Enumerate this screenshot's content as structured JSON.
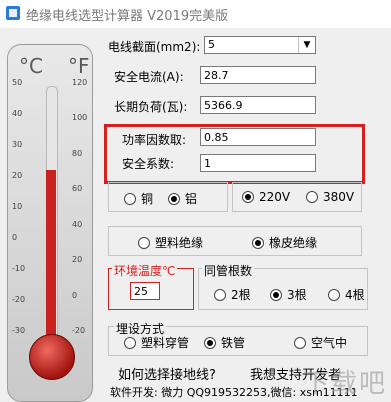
{
  "window": {
    "title": "绝缘电线选型计算器 V2019完美版"
  },
  "thermometer": {
    "celsius_label": "°C",
    "fahrenheit_label": "°F",
    "celsius_scale": [
      "50",
      "40",
      "30",
      "20",
      "10",
      "0",
      "-10",
      "-20",
      "-30"
    ],
    "fahrenheit_scale": [
      "120",
      "100",
      "80",
      "60",
      "40",
      "20",
      "0",
      "-20"
    ],
    "fill_level_celsius": 25
  },
  "fields": {
    "section_label": "电线截面(mm2):",
    "section_value": "5",
    "current_label": "安全电流(A):",
    "current_value": "28.7",
    "load_label": "长期负荷(瓦):",
    "load_value": "5366.9",
    "pf_label": "功率因数取:",
    "pf_value": "0.85",
    "safety_label": "安全系数:",
    "safety_value": "1"
  },
  "material": {
    "copper": "铜",
    "aluminum": "铝",
    "selected": "铝"
  },
  "voltage": {
    "v220": "220V",
    "v380": "380V",
    "selected": "220V"
  },
  "insulation": {
    "plastic": "塑料绝缘",
    "rubber": "橡皮绝缘",
    "selected": "橡皮绝缘"
  },
  "env": {
    "label": "环境温度℃",
    "value": "25"
  },
  "roots": {
    "label": "同管根数",
    "r2": "2根",
    "r3": "3根",
    "r4": "4根",
    "selected": "3根"
  },
  "laying": {
    "label": "埋设方式",
    "plastic_pipe": "塑料穿管",
    "iron_pipe": "铁管",
    "air": "空气中",
    "selected": "铁管"
  },
  "links": {
    "ground": "如何选择接地线?",
    "support": "我想支持开发者"
  },
  "footer": {
    "text": "软件开发: 微力 QQ919532253,微信: xsm11111"
  },
  "watermark": "下载吧"
}
